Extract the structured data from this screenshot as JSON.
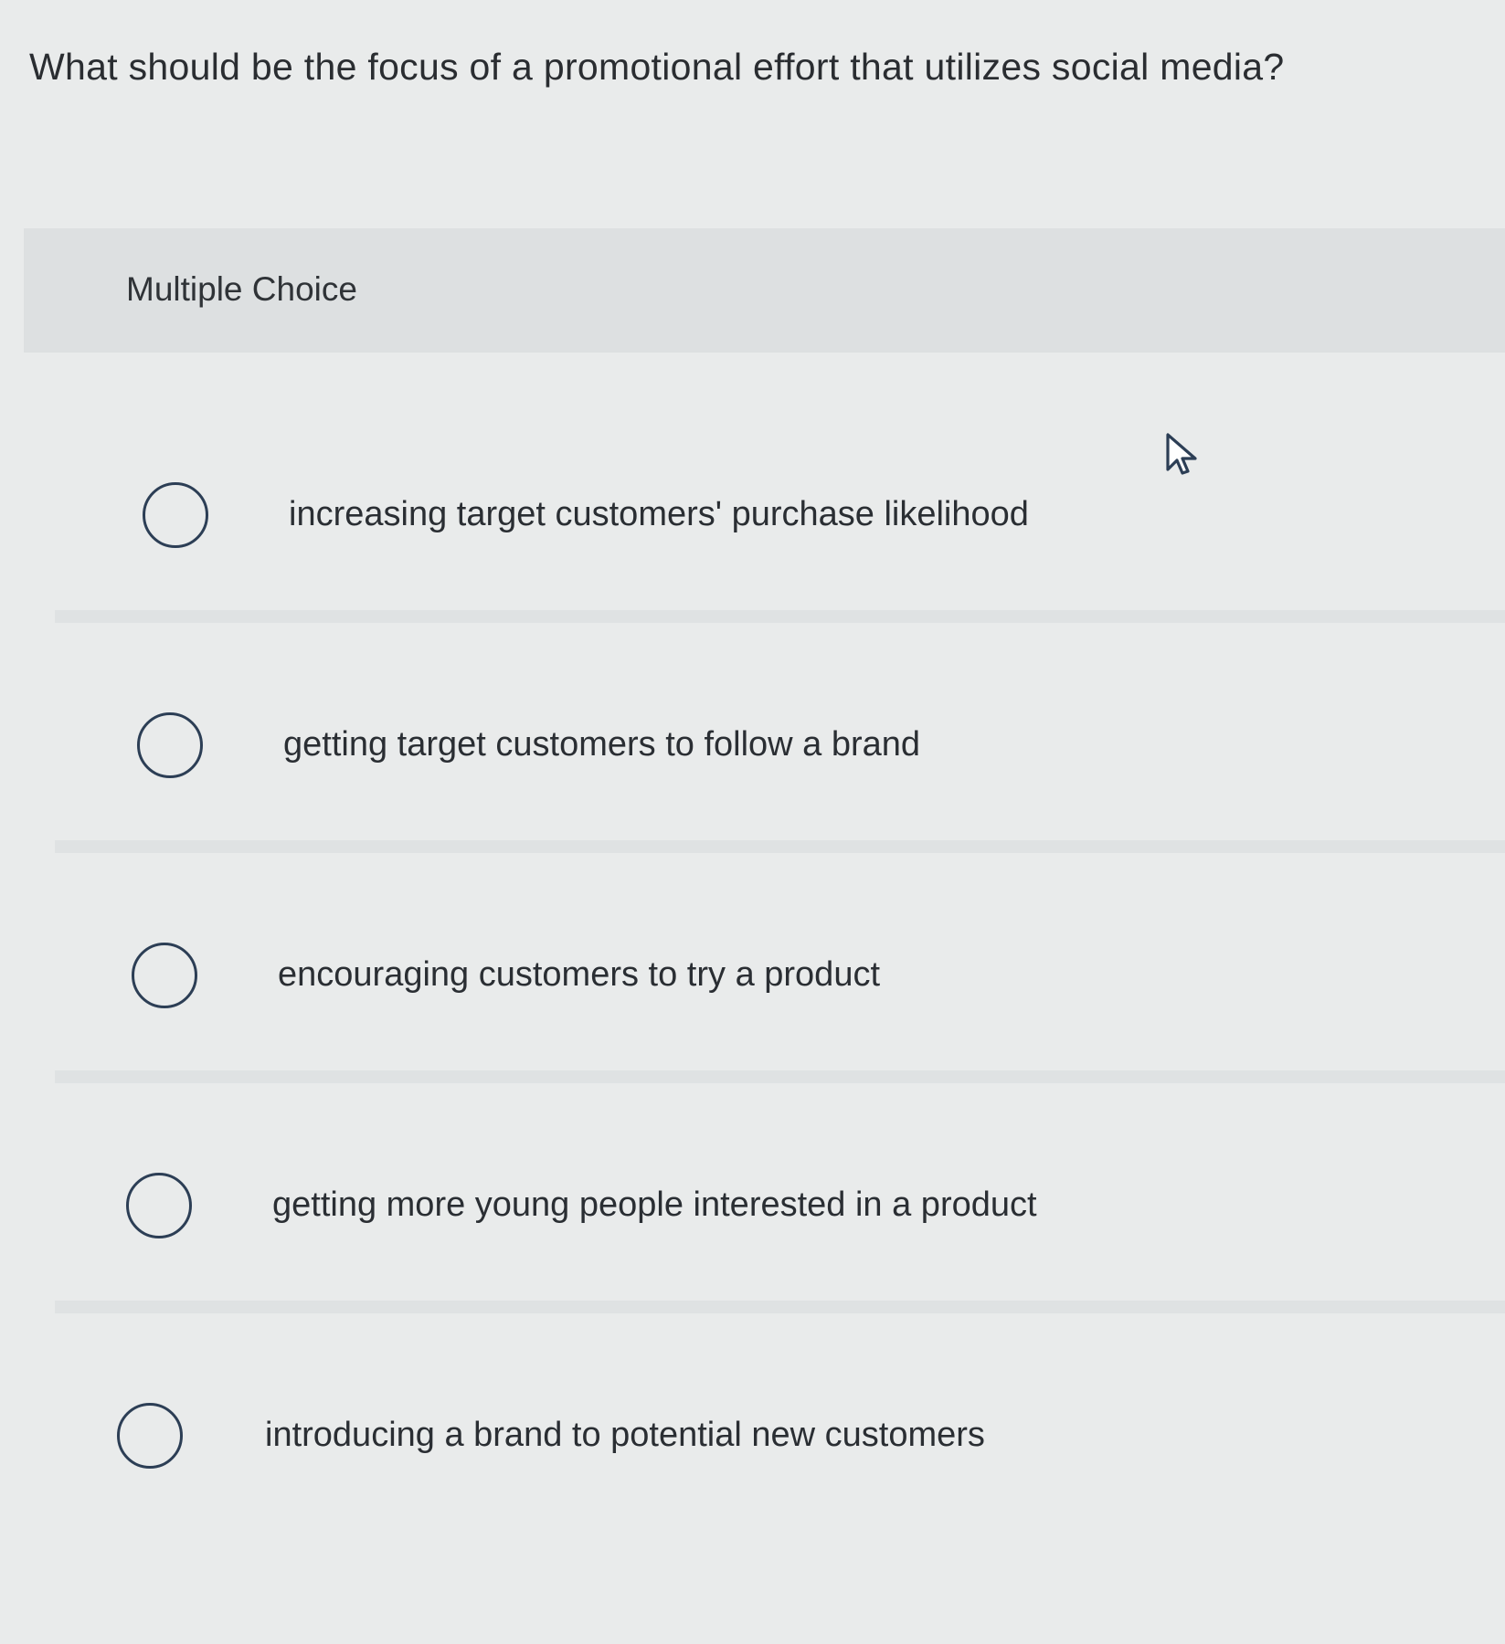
{
  "question": {
    "text": "What should be the focus of a promotional effort that utilizes social media?"
  },
  "multiple_choice": {
    "label": "Multiple Choice"
  },
  "options": [
    {
      "label": "increasing target customers' purchase likelihood",
      "selected": false
    },
    {
      "label": "getting target customers to follow a brand",
      "selected": false
    },
    {
      "label": "encouraging customers to try a product",
      "selected": false
    },
    {
      "label": "getting more young people interested in a product",
      "selected": false
    },
    {
      "label": "introducing a brand to potential new customers",
      "selected": false
    }
  ],
  "icons": {
    "radio": "radio-unselected-icon",
    "cursor": "mouse-pointer-icon"
  },
  "colors": {
    "background": "#e9ebeb",
    "header_band": "#dde0e1",
    "radio_border": "#2c3e55",
    "text": "#2a2d31"
  }
}
